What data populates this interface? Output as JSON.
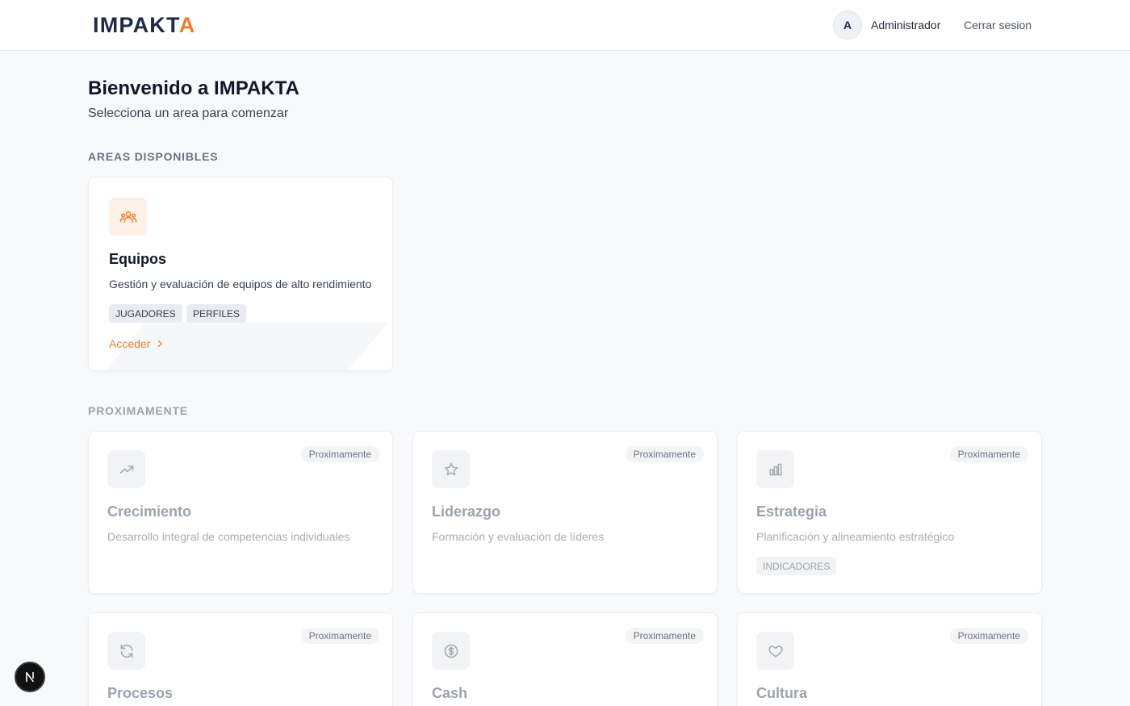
{
  "header": {
    "logo_main": "IMPAKT",
    "logo_accent": "A",
    "avatar_initial": "A",
    "username": "Administrador",
    "logout_label": "Cerrar sesion"
  },
  "page": {
    "title": "Bienvenido a IMPAKTA",
    "subtitle": "Selecciona un area para comenzar"
  },
  "available": {
    "label": "AREAS DISPONIBLES",
    "cards": [
      {
        "title": "Equipos",
        "description": "Gestión y evaluación de equipos de alto rendimiento",
        "icon": "users-icon",
        "tags": [
          "JUGADORES",
          "PERFILES"
        ],
        "action_label": "Acceder"
      }
    ]
  },
  "upcoming": {
    "label": "PROXIMAMENTE",
    "badge_label": "Proximamente",
    "cards": [
      {
        "title": "Crecimiento",
        "description": "Desarrollo integral de competencias individuales",
        "icon": "trending-up-icon",
        "tags": []
      },
      {
        "title": "Liderazgo",
        "description": "Formación y evaluación de líderes",
        "icon": "star-icon",
        "tags": []
      },
      {
        "title": "Estrategia",
        "description": "Planificación y alineamiento estratégico",
        "icon": "bar-chart-icon",
        "tags": [
          "INDICADORES"
        ]
      },
      {
        "title": "Procesos",
        "description": "",
        "icon": "refresh-icon",
        "tags": []
      },
      {
        "title": "Cash",
        "description": "",
        "icon": "dollar-circle-icon",
        "tags": []
      },
      {
        "title": "Cultura",
        "description": "",
        "icon": "heart-icon",
        "tags": []
      }
    ]
  },
  "colors": {
    "brand_navy": "#1f2a44",
    "brand_orange": "#f07f2b",
    "background": "#f8f9fb"
  },
  "fab": {
    "letter": "N"
  }
}
